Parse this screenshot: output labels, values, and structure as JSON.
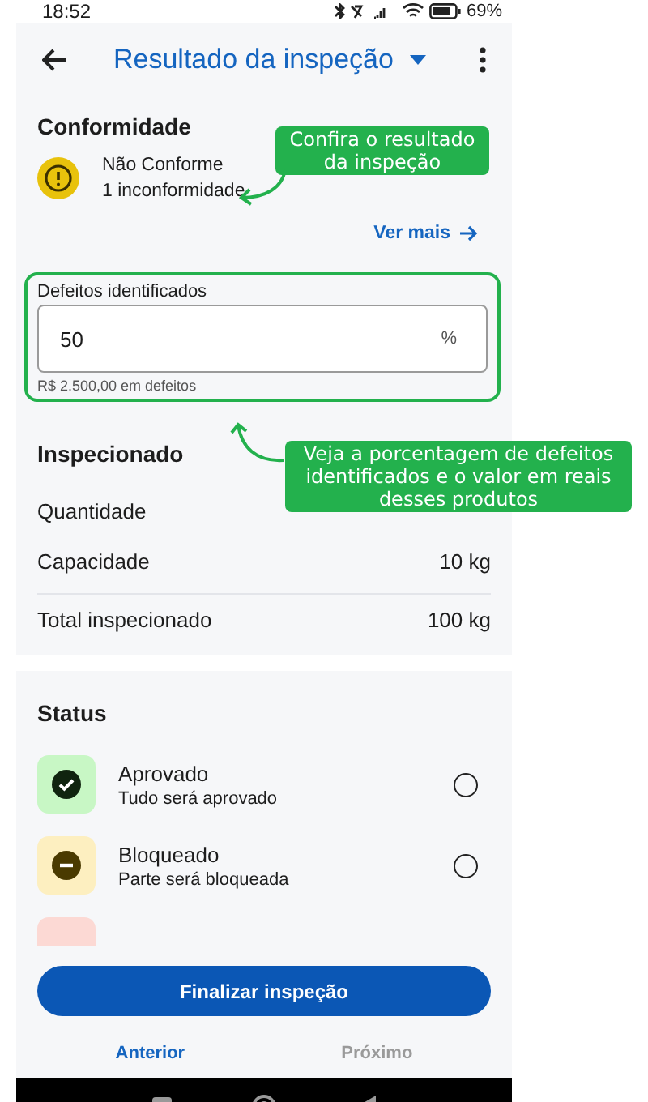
{
  "status_bar": {
    "time": "18:52",
    "battery": "69%"
  },
  "app_bar": {
    "title": "Resultado da inspeção"
  },
  "conformity": {
    "heading": "Conformidade",
    "status": "Não Conforme",
    "detail": "1 inconformidade",
    "link": "Ver mais"
  },
  "defects_field": {
    "label": "Defeitos identificados",
    "value": "50",
    "suffix": "%",
    "helper": "R$ 2.500,00 em defeitos",
    "highlighted": true
  },
  "inspected": {
    "heading": "Inspecionado",
    "rows": [
      {
        "label": "Quantidade"
      },
      {
        "label": "Capacidade",
        "value": "10 kg"
      },
      {
        "label": "Total inspecionado",
        "value": "100 kg"
      }
    ]
  },
  "status": {
    "heading": "Status",
    "items": [
      {
        "kind": "approved",
        "label": "Aprovado",
        "description": "Tudo será aprovado",
        "selected": false,
        "color": "#c8f7c5"
      },
      {
        "kind": "blocked",
        "label": "Bloqueado",
        "description": "Parte será bloqueada",
        "selected": false,
        "color": "#fdefc0"
      },
      {
        "kind": "partial",
        "color": "#fcd9d4"
      }
    ]
  },
  "footer": {
    "primary_button": "Finalizar inspeção",
    "previous": {
      "label": "Anterior",
      "disabled": false
    },
    "next": {
      "label": "Próximo",
      "disabled": true
    }
  },
  "annotations": [
    {
      "text": "Confira o resultado da inspeção"
    },
    {
      "text": "Veja a porcentagem de defeitos identificados e o valor em reais desses produtos"
    }
  ]
}
